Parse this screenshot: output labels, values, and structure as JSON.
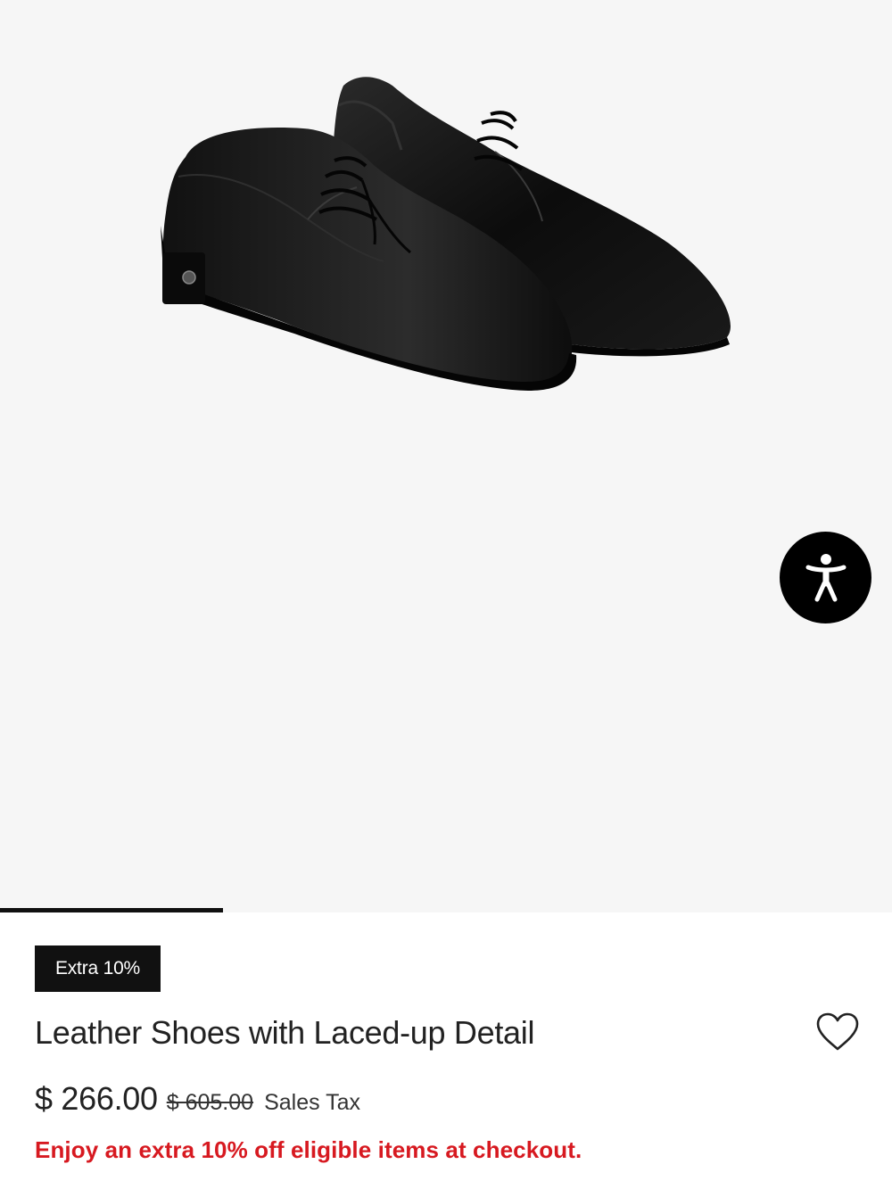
{
  "gallery": {
    "image_alt": "Black leather derby shoes",
    "progress_fraction": 0.25,
    "accessibility_icon": "accessibility-icon"
  },
  "product": {
    "badge": "Extra 10%",
    "title": "Leather Shoes with Laced-up Detail",
    "price": "$ 266.00",
    "original_price": "$ 605.00",
    "tax_note": "Sales Tax",
    "promo": "Enjoy an extra 10% off eligible items at checkout.",
    "wishlist_icon": "heart-outline-icon"
  },
  "colors": {
    "promo": "#d71920",
    "badge_bg": "#111111",
    "gallery_bg": "#f6f6f6"
  }
}
